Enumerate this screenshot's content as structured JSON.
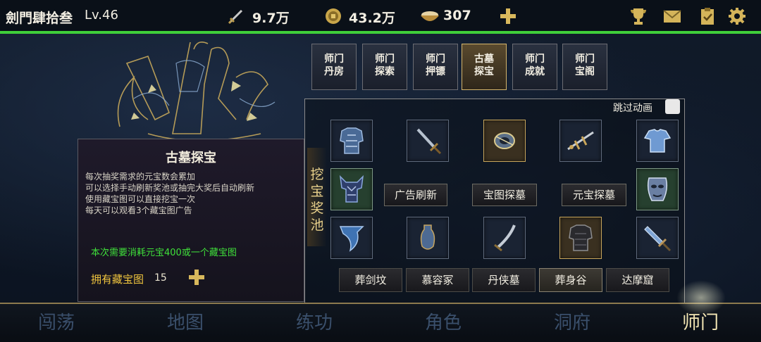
{
  "player": {
    "name": "劍門肆拾叁",
    "level": "Lv.46"
  },
  "resources": {
    "power": "9.7万",
    "gold": "43.2万",
    "food": "307"
  },
  "sect_tabs": [
    {
      "line1": "师门",
      "line2": "丹房"
    },
    {
      "line1": "师门",
      "line2": "探索"
    },
    {
      "line1": "师门",
      "line2": "押镖"
    },
    {
      "line1": "古墓",
      "line2": "探宝"
    },
    {
      "line1": "师门",
      "line2": "成就"
    },
    {
      "line1": "师门",
      "line2": "宝阁"
    }
  ],
  "info": {
    "title": "古墓探宝",
    "lines": [
      "每次抽奖需求的元宝数会累加",
      "可以选择手动刷新奖池或抽完大奖后自动刷新",
      "使用藏宝图可以直接挖宝一次",
      "每天可以观看3个藏宝图广告"
    ],
    "cost_text": "本次需要消耗元宝400或一个藏宝图",
    "own_label": "拥有藏宝图",
    "own_count": "15"
  },
  "pool": {
    "label": "挖宝奖池",
    "skip_label": "跳过动画",
    "items": [
      {
        "icon": "armor-icon"
      },
      {
        "icon": "sword-icon"
      },
      {
        "icon": "bracer-icon"
      },
      {
        "icon": "ornate-sword-icon"
      },
      {
        "icon": "robe-icon"
      },
      {
        "icon": "dragon-armor-icon"
      },
      {
        "icon": "mask-icon"
      },
      {
        "icon": "scarf-icon"
      },
      {
        "icon": "vase-icon"
      },
      {
        "icon": "saber-icon"
      },
      {
        "icon": "dark-armor-icon"
      },
      {
        "icon": "dagger-icon"
      }
    ],
    "actions": [
      "广告刷新",
      "宝图探墓",
      "元宝探墓"
    ]
  },
  "tombs": [
    "葬剑坟",
    "慕容冢",
    "丹侠墓",
    "葬身谷",
    "达摩窟"
  ],
  "nav": [
    "闯荡",
    "地图",
    "练功",
    "角色",
    "洞府",
    "师门"
  ],
  "colors": {
    "accent_green": "#3fcf3a",
    "gold": "#d5b56b",
    "nav_inactive": "#3a4f6b",
    "nav_active": "#f3e6b4"
  }
}
